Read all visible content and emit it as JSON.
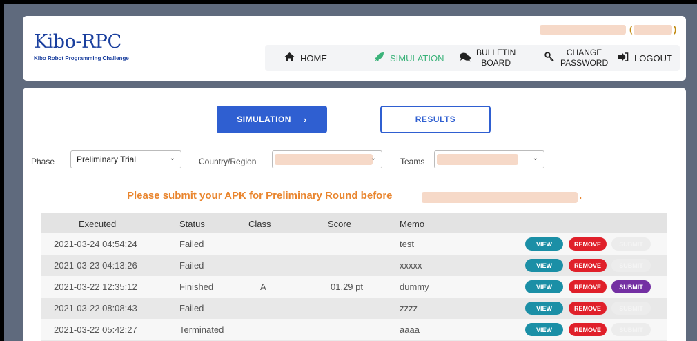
{
  "brand": {
    "title": "Kibo-RPC",
    "subtitle": "Kibo Robot Programming Challenge"
  },
  "user": {
    "open_paren": "(",
    "close_paren": ")"
  },
  "nav": {
    "home": "HOME",
    "simulation": "SIMULATION",
    "bulletin_line1": "BULLETIN",
    "bulletin_line2": "BOARD",
    "change_line1": "CHANGE",
    "change_line2": "PASSWORD",
    "logout": "LOGOUT"
  },
  "tabs": {
    "simulation": "SIMULATION",
    "results": "RESULTS"
  },
  "filters": {
    "phase_label": "Phase",
    "phase_value": "Preliminary Trial",
    "country_label": "Country/Region",
    "teams_label": "Teams"
  },
  "notice": "Please submit your APK for Preliminary Round before",
  "table": {
    "headers": {
      "executed": "Executed",
      "status": "Status",
      "class": "Class",
      "score": "Score",
      "memo": "Memo"
    },
    "rows": [
      {
        "executed": "2021-03-24 04:54:24",
        "status": "Failed",
        "class": "",
        "score": "",
        "memo": "test",
        "submit_enabled": false
      },
      {
        "executed": "2021-03-23 04:13:26",
        "status": "Failed",
        "class": "",
        "score": "",
        "memo": "xxxxx",
        "submit_enabled": false
      },
      {
        "executed": "2021-03-22 12:35:12",
        "status": "Finished",
        "class": "A",
        "score": "01.29 pt",
        "memo": "dummy",
        "submit_enabled": true
      },
      {
        "executed": "2021-03-22 08:08:43",
        "status": "Failed",
        "class": "",
        "score": "",
        "memo": "zzzz",
        "submit_enabled": false
      },
      {
        "executed": "2021-03-22 05:42:27",
        "status": "Terminated",
        "class": "",
        "score": "",
        "memo": "aaaa",
        "submit_enabled": false
      }
    ],
    "view_label": "VIEW",
    "remove_label": "REMOVE",
    "submit_label": "SUBMIT"
  },
  "colors": {
    "brand": "#1a3f9e",
    "active_nav": "#3bb37a",
    "primary": "#2f5fd1",
    "notice": "#e9852e",
    "view": "#1b8fa6",
    "remove": "#e0202a",
    "submit": "#7430a3"
  }
}
